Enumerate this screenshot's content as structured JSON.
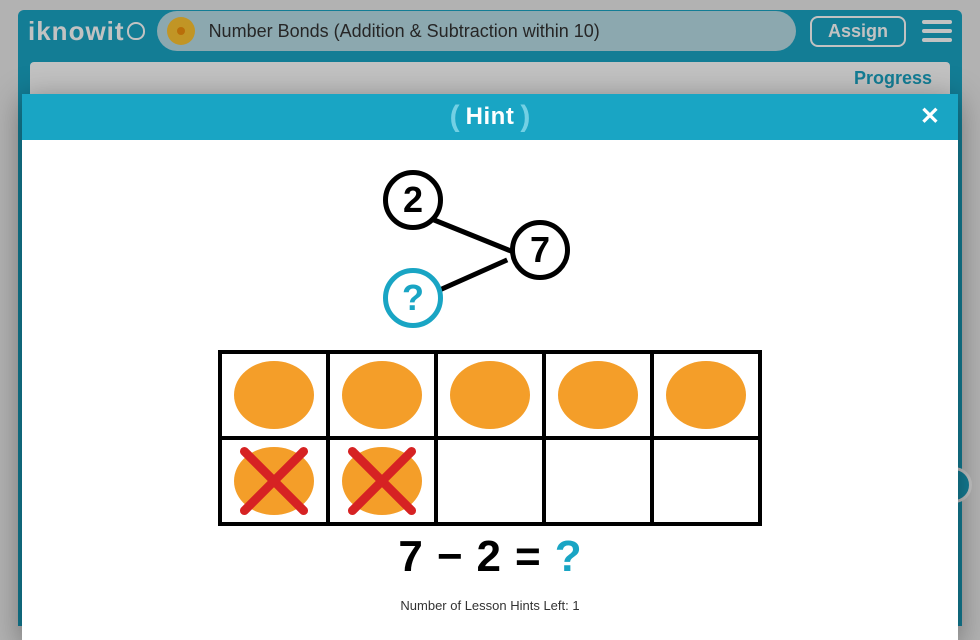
{
  "header": {
    "logo_text": "iknowit",
    "lesson_title": "Number Bonds (Addition & Subtraction within 10)",
    "assign_label": "Assign"
  },
  "page": {
    "progress_label": "Progress"
  },
  "modal": {
    "title": "Hint"
  },
  "bond": {
    "left": "2",
    "whole": "7",
    "right": "?"
  },
  "tenframe": {
    "circle_color": "#f49e29",
    "cells": [
      {
        "filled": true,
        "crossed": false
      },
      {
        "filled": true,
        "crossed": false
      },
      {
        "filled": true,
        "crossed": false
      },
      {
        "filled": true,
        "crossed": false
      },
      {
        "filled": true,
        "crossed": false
      },
      {
        "filled": true,
        "crossed": true
      },
      {
        "filled": true,
        "crossed": true
      },
      {
        "filled": false,
        "crossed": false
      },
      {
        "filled": false,
        "crossed": false
      },
      {
        "filled": false,
        "crossed": false
      }
    ]
  },
  "equation": {
    "a": "7",
    "op": "−",
    "b": "2",
    "eq": "=",
    "ans": "?"
  },
  "hints_left_text": "Number of Lesson Hints Left: 1"
}
